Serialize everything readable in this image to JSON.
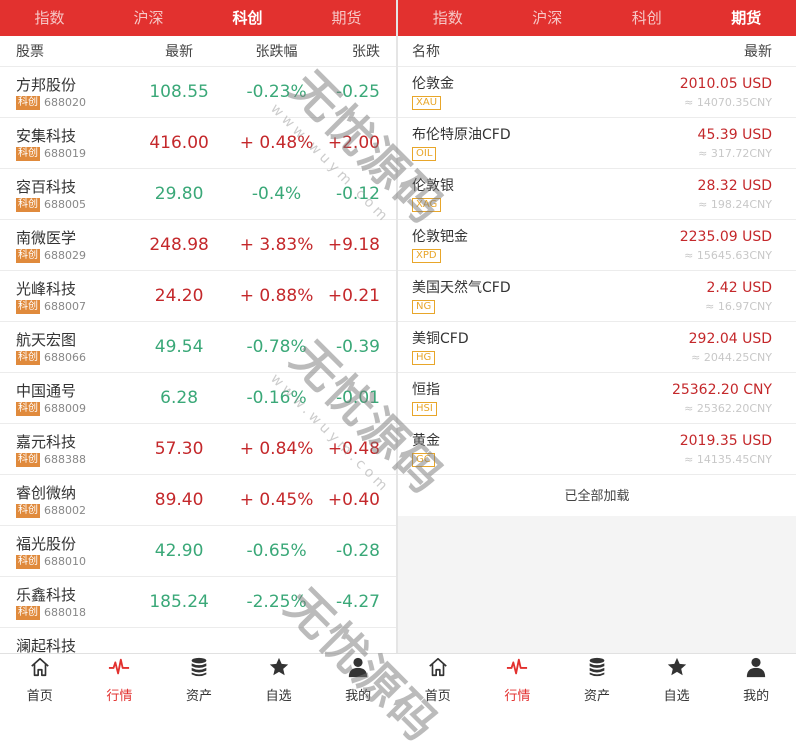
{
  "left": {
    "tabs": [
      {
        "label": "指数",
        "active": false
      },
      {
        "label": "沪深",
        "active": false
      },
      {
        "label": "科创",
        "active": true
      },
      {
        "label": "期货",
        "active": false
      }
    ],
    "columns": {
      "name": "股票",
      "price": "最新",
      "pct": "张跌幅",
      "chg": "张跌"
    },
    "rows": [
      {
        "name": "方邦股份",
        "tag": "科创",
        "code": "688020",
        "price": "108.55",
        "pct": "-0.23%",
        "chg": "-0.25",
        "dir": "down"
      },
      {
        "name": "安集科技",
        "tag": "科创",
        "code": "688019",
        "price": "416.00",
        "pct": "+ 0.48%",
        "chg": "+2.00",
        "dir": "up"
      },
      {
        "name": "容百科技",
        "tag": "科创",
        "code": "688005",
        "price": "29.80",
        "pct": "-0.4%",
        "chg": "-0.12",
        "dir": "down"
      },
      {
        "name": "南微医学",
        "tag": "科创",
        "code": "688029",
        "price": "248.98",
        "pct": "+ 3.83%",
        "chg": "+9.18",
        "dir": "up"
      },
      {
        "name": "光峰科技",
        "tag": "科创",
        "code": "688007",
        "price": "24.20",
        "pct": "+ 0.88%",
        "chg": "+0.21",
        "dir": "up"
      },
      {
        "name": "航天宏图",
        "tag": "科创",
        "code": "688066",
        "price": "49.54",
        "pct": "-0.78%",
        "chg": "-0.39",
        "dir": "down"
      },
      {
        "name": "中国通号",
        "tag": "科创",
        "code": "688009",
        "price": "6.28",
        "pct": "-0.16%",
        "chg": "-0.01",
        "dir": "down"
      },
      {
        "name": "嘉元科技",
        "tag": "科创",
        "code": "688388",
        "price": "57.30",
        "pct": "+ 0.84%",
        "chg": "+0.48",
        "dir": "up"
      },
      {
        "name": "睿创微纳",
        "tag": "科创",
        "code": "688002",
        "price": "89.40",
        "pct": "+ 0.45%",
        "chg": "+0.40",
        "dir": "up"
      },
      {
        "name": "福光股份",
        "tag": "科创",
        "code": "688010",
        "price": "42.90",
        "pct": "-0.65%",
        "chg": "-0.28",
        "dir": "down"
      },
      {
        "name": "乐鑫科技",
        "tag": "科创",
        "code": "688018",
        "price": "185.24",
        "pct": "-2.25%",
        "chg": "-4.27",
        "dir": "down"
      },
      {
        "name": "澜起科技",
        "tag": "科创",
        "code": "",
        "price": "",
        "pct": "",
        "chg": "",
        "dir": "down"
      }
    ]
  },
  "right": {
    "tabs": [
      {
        "label": "指数",
        "active": false
      },
      {
        "label": "沪深",
        "active": false
      },
      {
        "label": "科创",
        "active": false
      },
      {
        "label": "期货",
        "active": true
      }
    ],
    "columns": {
      "name": "名称",
      "price": "最新"
    },
    "rows": [
      {
        "name": "伦敦金",
        "code": "XAU",
        "price": "2010.05 USD",
        "cny": "≈ 14070.35CNY"
      },
      {
        "name": "布伦特原油CFD",
        "code": "OIL",
        "price": "45.39 USD",
        "cny": "≈ 317.72CNY"
      },
      {
        "name": "伦敦银",
        "code": "XAG",
        "price": "28.32 USD",
        "cny": "≈ 198.24CNY"
      },
      {
        "name": "伦敦钯金",
        "code": "XPD",
        "price": "2235.09 USD",
        "cny": "≈ 15645.63CNY"
      },
      {
        "name": "美国天然气CFD",
        "code": "NG",
        "price": "2.42 USD",
        "cny": "≈ 16.97CNY"
      },
      {
        "name": "美铜CFD",
        "code": "HG",
        "price": "292.04 USD",
        "cny": "≈ 2044.25CNY"
      },
      {
        "name": "恒指",
        "code": "HSI",
        "price": "25362.20 CNY",
        "cny": "≈ 25362.20CNY"
      },
      {
        "name": "黄金",
        "code": "GC",
        "price": "2019.35 USD",
        "cny": "≈ 14135.45CNY"
      }
    ],
    "loaded_text": "已全部加载"
  },
  "nav": {
    "items": [
      {
        "label": "首页",
        "icon": "home-icon",
        "active": false
      },
      {
        "label": "行情",
        "icon": "pulse-chart-icon",
        "active": true
      },
      {
        "label": "资产",
        "icon": "coin-stack-icon",
        "active": false
      },
      {
        "label": "自选",
        "icon": "star-icon",
        "active": false
      },
      {
        "label": "我的",
        "icon": "user-icon",
        "active": false
      }
    ]
  },
  "watermark": {
    "text": "无忧源码",
    "url": "www.wuym.com"
  },
  "colors": {
    "brand_red": "#e2312f",
    "up": "#c4282b",
    "down": "#3aa878",
    "tag_orange": "#e08a3c",
    "future_tag": "#e8a62a"
  }
}
